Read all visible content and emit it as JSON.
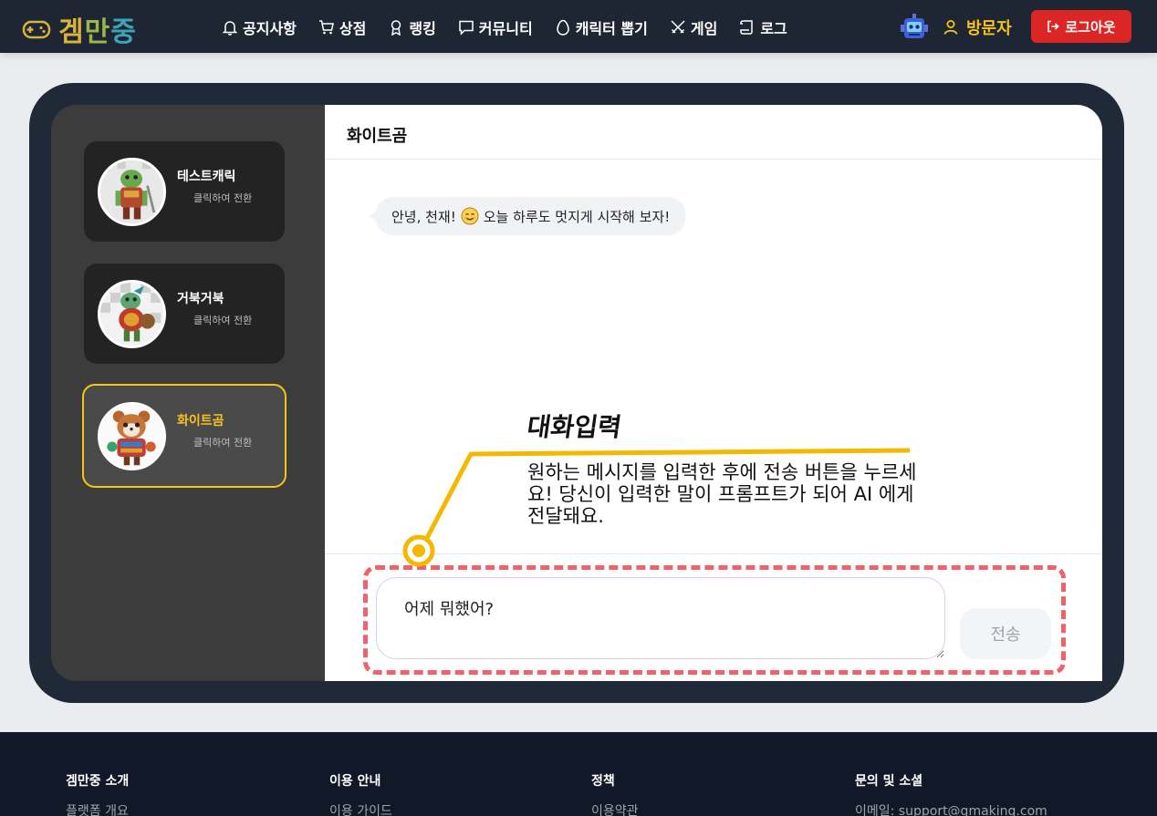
{
  "brand": {
    "name": "겜만중",
    "colors": [
      "#d8b43a",
      "#9bb64a",
      "#3fa3b6"
    ]
  },
  "nav": {
    "items": [
      {
        "label": "공지사항",
        "icon": "bell-icon"
      },
      {
        "label": "상점",
        "icon": "cart-icon"
      },
      {
        "label": "랭킹",
        "icon": "award-icon"
      },
      {
        "label": "커뮤니티",
        "icon": "chat-icon"
      },
      {
        "label": "캐릭터 뽑기",
        "icon": "egg-icon"
      },
      {
        "label": "게임",
        "icon": "swords-icon"
      },
      {
        "label": "로그",
        "icon": "scroll-icon"
      }
    ]
  },
  "user": {
    "name": "방문자",
    "logout_label": "로그아웃",
    "accent": "#f7c21b",
    "logout_color": "#dc2626"
  },
  "sidebar": {
    "characters": [
      {
        "name": "테스트캐릭",
        "hint": "클릭하여 전환",
        "active": false
      },
      {
        "name": "거북거북",
        "hint": "클릭하여 전환",
        "active": false
      },
      {
        "name": "화이트곰",
        "hint": "클릭하여 전환",
        "active": true
      }
    ]
  },
  "chat": {
    "title": "화이트곰",
    "messages": [
      {
        "before": "안녕, 천재!",
        "emoji": "smiling-face-icon",
        "after": "오늘 하루도 멋지게 시작해 보자!"
      }
    ],
    "input_value": "어제 뭐했어?",
    "send_label": "전송"
  },
  "tutorial": {
    "title": "대화입력",
    "desc": "원하는 메시지를 입력한 후에 전송 버튼을 누르세요! 당신이 입력한 말이 프롬프트가 되어 AI 에게 전달돼요.",
    "line_color": "#f5b800",
    "box_color": "#f0626a"
  },
  "footer": {
    "columns": [
      {
        "title": "겜만중 소개",
        "link": "플랫폼 개요"
      },
      {
        "title": "이용 안내",
        "link": "이용 가이드"
      },
      {
        "title": "정책",
        "link": "이용약관"
      },
      {
        "title": "문의 및 소셜",
        "link": "이메일: support@gmaking.com"
      }
    ]
  }
}
